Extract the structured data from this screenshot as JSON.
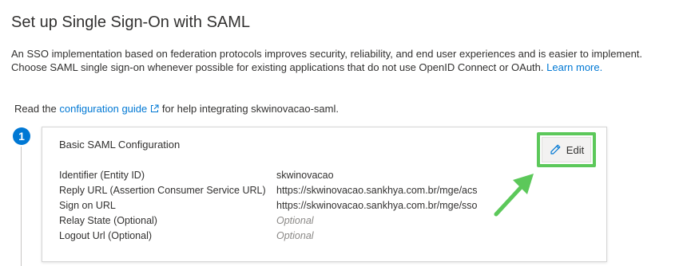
{
  "header": {
    "title": "Set up Single Sign-On with SAML"
  },
  "intro": {
    "text": "An SSO implementation based on federation protocols improves security, reliability, and end user experiences and is easier to implement. Choose SAML single sign-on whenever possible for existing applications that do not use OpenID Connect or OAuth.",
    "learn_more": "Learn more."
  },
  "guide": {
    "prefix": "Read the",
    "link": "configuration guide",
    "suffix": "for help integrating skwinovacao-saml.",
    "link_icon": "external-link-icon"
  },
  "step": {
    "number": "1"
  },
  "card": {
    "title": "Basic SAML Configuration",
    "edit_label": "Edit",
    "edit_icon": "pencil-icon",
    "rows": [
      {
        "label": "Identifier (Entity ID)",
        "value": "skwinovacao"
      },
      {
        "label": "Reply URL (Assertion Consumer Service URL)",
        "value": "https://skwinovacao.sankhya.com.br/mge/acs"
      },
      {
        "label": "Sign on URL",
        "value": "https://skwinovacao.sankhya.com.br/mge/sso"
      },
      {
        "label": "Relay State (Optional)",
        "value": "Optional"
      },
      {
        "label": "Logout Url (Optional)",
        "value": "Optional"
      }
    ]
  },
  "colors": {
    "accent": "#0078d4",
    "highlight": "#5cc85a",
    "text": "#323130",
    "placeholder": "#8a8886"
  }
}
